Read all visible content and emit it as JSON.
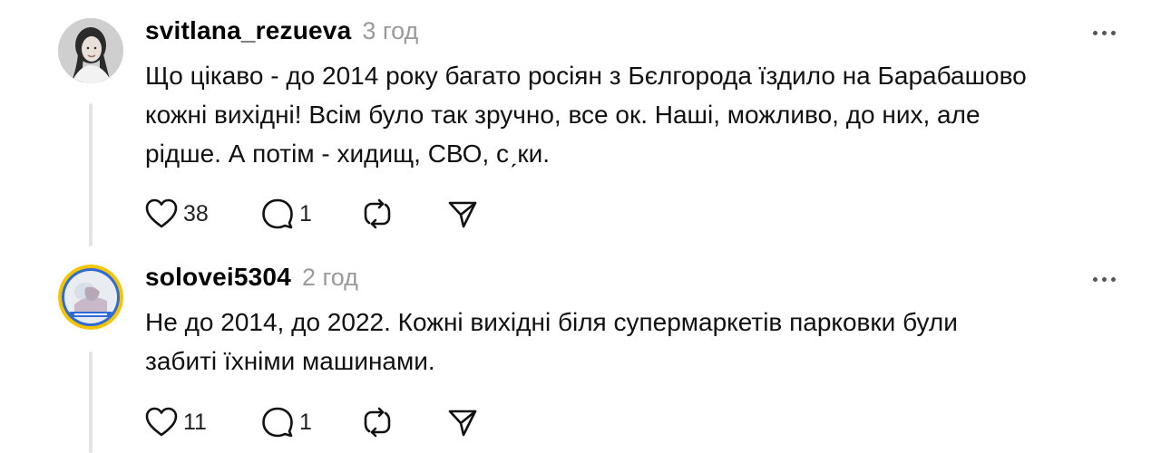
{
  "posts": [
    {
      "username": "svitlana_rezueva",
      "time": "3 год",
      "avatar_icon": "user-photo-woman",
      "text_lines": [
        "Що цікаво - до 2014 року багато росіян з Бєлгорода їздило на Барабашово",
        "кожні вихідні! Всім було так зручно, все ок. Наші, можливо, до них, але",
        "рідше. А потім - хидищ, СВО, сˏки."
      ],
      "likes": "38",
      "replies": "1",
      "icons": [
        "heart-icon",
        "reply-icon",
        "repost-icon",
        "share-icon",
        "more-icon"
      ]
    },
    {
      "username": "solovei5304",
      "time": "2 год",
      "avatar_icon": "user-photo-ukraine-frame",
      "text_lines": [
        "Не до 2014, до 2022. Кожні вихідні біля супермаркетів парковки були",
        "забиті їхніми машинами."
      ],
      "likes": "11",
      "replies": "1",
      "icons": [
        "heart-icon",
        "reply-icon",
        "repost-icon",
        "share-icon",
        "more-icon"
      ]
    }
  ],
  "colors": {
    "text": "#111111",
    "muted": "#9a9a9a",
    "thread_line": "#e4e4e4",
    "ukraine_blue": "#2f6bd6",
    "ukraine_yellow": "#f4c400"
  }
}
